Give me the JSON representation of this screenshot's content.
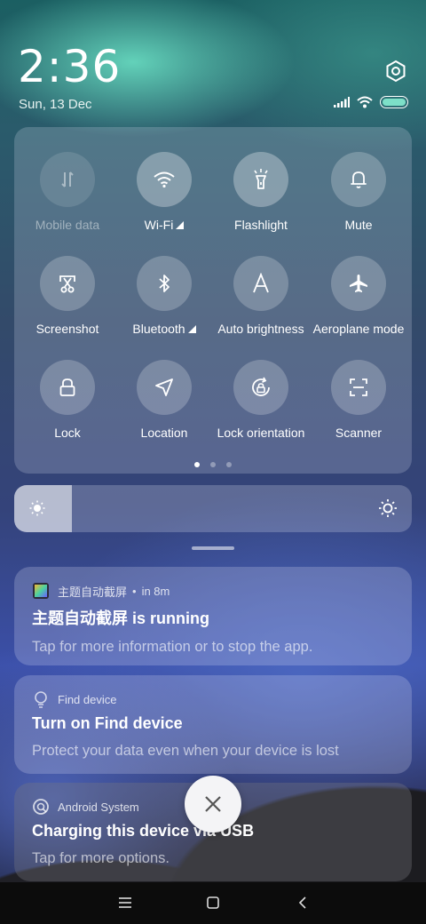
{
  "status": {
    "time": "2:36",
    "date": "Sun, 13 Dec",
    "battery_level": 1.0,
    "icons": [
      "signal-icon",
      "wifi-icon",
      "battery-icon"
    ]
  },
  "quick_settings": {
    "tiles": [
      {
        "label": "Mobile data",
        "icon": "mobile-data-icon",
        "state": "disabled"
      },
      {
        "label": "Wi-Fi",
        "icon": "wifi-icon",
        "state": "on"
      },
      {
        "label": "Flashlight",
        "icon": "flashlight-icon",
        "state": "on"
      },
      {
        "label": "Mute",
        "icon": "bell-icon",
        "state": "off"
      },
      {
        "label": "Screenshot",
        "icon": "scissors-icon",
        "state": "off"
      },
      {
        "label": "Bluetooth",
        "icon": "bluetooth-icon",
        "state": "off"
      },
      {
        "label": "Auto brightness",
        "icon": "auto-brightness-icon",
        "state": "off"
      },
      {
        "label": "Aeroplane mode",
        "icon": "aeroplane-icon",
        "state": "off"
      },
      {
        "label": "Lock",
        "icon": "lock-icon",
        "state": "off"
      },
      {
        "label": "Location",
        "icon": "location-icon",
        "state": "off"
      },
      {
        "label": "Lock orientation",
        "icon": "rotation-lock-icon",
        "state": "off"
      },
      {
        "label": "Scanner",
        "icon": "scanner-icon",
        "state": "off"
      }
    ],
    "page_count": 3,
    "current_page": 1
  },
  "brightness": {
    "level": 0.145
  },
  "notifications": [
    {
      "app": "主题自动截屏",
      "time": "in 8m",
      "title": "主题自动截屏 is running",
      "body": "Tap for more information or to stop the app."
    },
    {
      "app": "Find device",
      "time": "",
      "title": "Turn on Find device",
      "body": "Protect your data even when your device is lost"
    },
    {
      "app": "Android System",
      "time": "",
      "title": "Charging this device via USB",
      "body": "Tap for more options."
    }
  ],
  "colors": {
    "battery_fill": "#7de0c8",
    "panel": "rgba(220,225,240,0.22)"
  }
}
